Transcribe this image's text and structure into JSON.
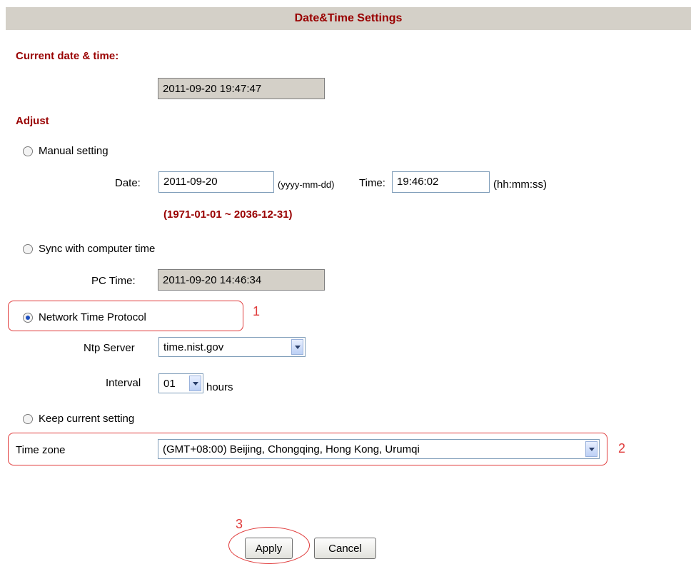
{
  "header": {
    "title": "Date&Time Settings"
  },
  "current": {
    "label": "Current date & time:",
    "value": "2011-09-20 19:47:47"
  },
  "adjust": {
    "label": "Adjust"
  },
  "manual": {
    "label": "Manual setting",
    "date_label": "Date:",
    "date_value": "2011-09-20",
    "date_format": "(yyyy-mm-dd)",
    "time_label": "Time:",
    "time_value": "19:46:02",
    "time_format": "(hh:mm:ss)",
    "range": "(1971-01-01 ~ 2036-12-31)"
  },
  "sync": {
    "label": "Sync with computer time",
    "pc_time_label": "PC Time:",
    "pc_time_value": "2011-09-20 14:46:34"
  },
  "ntp": {
    "label": "Network Time Protocol",
    "server_label": "Ntp Server",
    "server_value": "time.nist.gov",
    "interval_label": "Interval",
    "interval_value": "01",
    "interval_unit": "hours"
  },
  "keep": {
    "label": "Keep current setting"
  },
  "timezone": {
    "label": "Time zone",
    "value": "(GMT+08:00) Beijing, Chongqing, Hong Kong, Urumqi"
  },
  "buttons": {
    "apply": "Apply",
    "cancel": "Cancel"
  },
  "callouts": {
    "one": "1",
    "two": "2",
    "three": "3"
  },
  "colors": {
    "accent": "#990000",
    "callout": "#e03a3a",
    "header_bg": "#d4d0c8"
  }
}
